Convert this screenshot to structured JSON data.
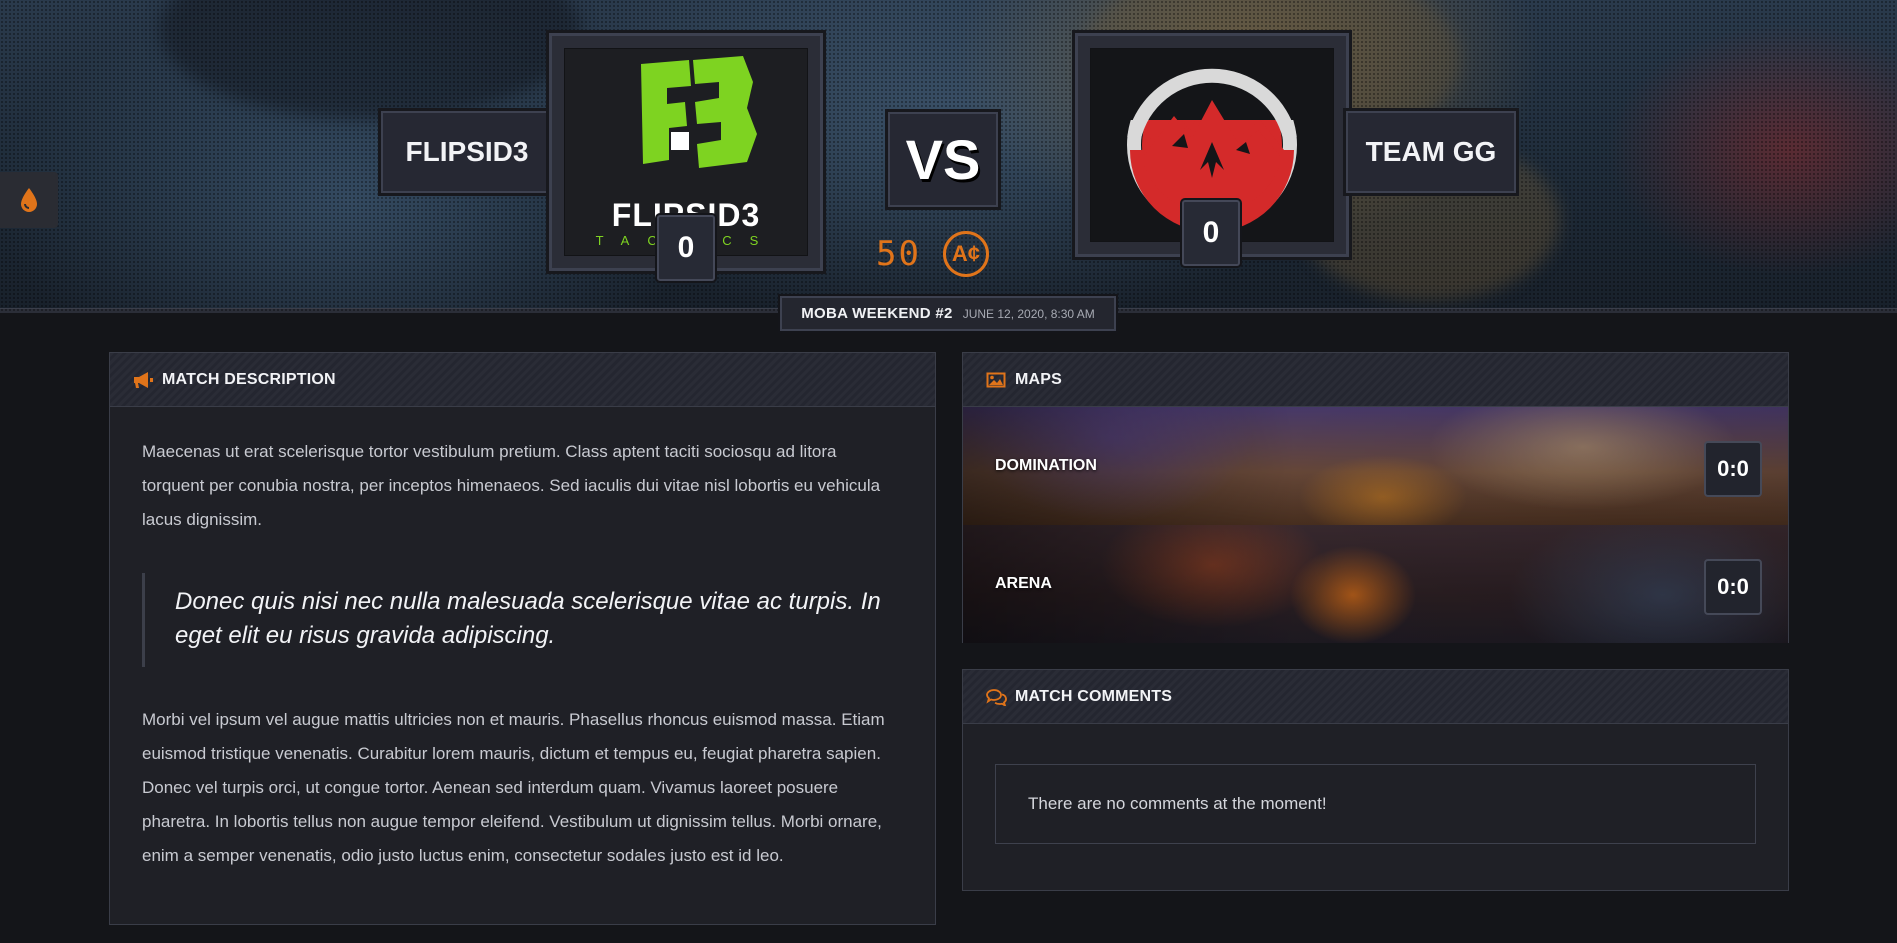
{
  "match": {
    "team1": {
      "name": "FLIPSID3",
      "score": "0",
      "logo_text": "FLIPSID3",
      "logo_subtext": "TACTICS"
    },
    "team2": {
      "name": "TEAM GG",
      "score": "0"
    },
    "vs_label": "VS",
    "points": "50",
    "currency_symbol": "A¢",
    "event_name": "MOBA WEEKEND #2",
    "event_date": "JUNE 12, 2020, 8:30 AM"
  },
  "description": {
    "title": "MATCH DESCRIPTION",
    "paragraph1": "Maecenas ut erat scelerisque tortor vestibulum pretium. Class aptent taciti sociosqu ad litora torquent per conubia nostra, per inceptos himenaeos. Sed iaculis dui vitae nisl lobortis eu vehicula lacus dignissim.",
    "quote": "Donec quis nisi nec nulla malesuada scelerisque vitae ac turpis. In eget elit eu risus gravida adipiscing.",
    "paragraph2": "Morbi vel ipsum vel augue mattis ultricies non et mauris. Phasellus rhoncus euismod massa. Etiam euismod tristique venenatis. Curabitur lorem mauris, dictum et tempus eu, feugiat pharetra sapien. Donec vel turpis orci, ut congue tortor. Aenean sed interdum quam. Vivamus laoreet posuere pharetra. In lobortis tellus non augue tempor eleifend. Vestibulum ut dignissim tellus. Morbi ornare, enim a semper venenatis, odio justo luctus enim, consectetur sodales justo est id leo."
  },
  "maps": {
    "title": "MAPS",
    "items": [
      {
        "name": "DOMINATION",
        "score": "0:0"
      },
      {
        "name": "ARENA",
        "score": "0:0"
      }
    ]
  },
  "comments": {
    "title": "MATCH COMMENTS",
    "empty_text": "There are no comments at the moment!"
  },
  "colors": {
    "accent": "#e0741a",
    "flipsid3_green": "#7ed321",
    "teamgg_red": "#d42a2a"
  },
  "icons": {
    "side_tab": "drop-icon",
    "description": "megaphone-icon",
    "maps": "image-icon",
    "comments": "comments-icon"
  }
}
